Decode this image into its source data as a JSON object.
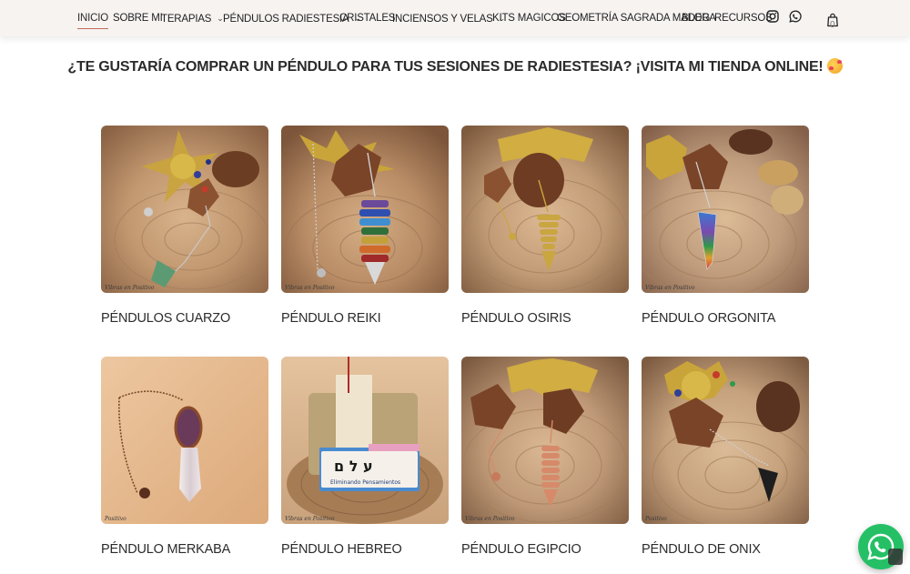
{
  "nav": {
    "items": [
      {
        "label": "INICIO",
        "active": true,
        "dropdown": false
      },
      {
        "label": "SOBRE MI",
        "active": false,
        "dropdown": false
      },
      {
        "label": "TERAPIAS",
        "active": false,
        "dropdown": true
      },
      {
        "label": "PÉNDULOS RADIESTESIA",
        "active": false,
        "dropdown": true
      },
      {
        "label": "CRISTALES",
        "active": false,
        "dropdown": false
      },
      {
        "label": "INCIENSOS Y VELAS",
        "active": false,
        "dropdown": true
      },
      {
        "label": "KITS MAGICOS",
        "active": false,
        "dropdown": false
      },
      {
        "label": "GEOMETRÍA SAGRADA MADERA",
        "active": false,
        "dropdown": false
      },
      {
        "label": "BLOG",
        "active": false,
        "dropdown": false
      },
      {
        "label": "RECURSOS",
        "active": false,
        "dropdown": false
      }
    ],
    "chevron": "⌄",
    "icons": [
      "instagram-icon",
      "whatsapp-icon",
      "shopping-bag-icon"
    ],
    "cart_count": "0"
  },
  "promo": {
    "text": "¿TE GUSTARÍA COMPRAR UN PÉNDULO PARA TUS SESIONES DE RADIESTESIA? ¡VISITA MI TIENDA ONLINE!",
    "emoji": "smiling-face-with-hearts"
  },
  "products": [
    {
      "title": "PÉNDULOS CUARZO",
      "stone": "#5c9a74",
      "bg": "#c49a74"
    },
    {
      "title": "PÉNDULO REIKI",
      "stone": "#4a5db0",
      "bg": "#b9916b"
    },
    {
      "title": "PÉNDULO OSIRIS",
      "stone": "#c9a640",
      "bg": "#c19b76"
    },
    {
      "title": "PÉNDULO ORGONITA",
      "stone": "#7a6ab0",
      "bg": "#bf9c7c"
    },
    {
      "title": "PÉNDULO MERKABA",
      "stone": "#d9ccd6",
      "bg": "#e2b88e"
    },
    {
      "title": "PÉNDULO HEBREO",
      "stone": "#4a8bd0",
      "bg": "#c9a27c"
    },
    {
      "title": "PÉNDULO EGIPCIO",
      "stone": "#d68a6a",
      "bg": "#c09a78"
    },
    {
      "title": "PÉNDULO DE ONIX",
      "stone": "#1e1e1e",
      "bg": "#c6a27e"
    }
  ],
  "colors": {
    "nav_bg": "#f6f3f1",
    "active_underline": "#c56a5c",
    "whatsapp": "#25c066"
  }
}
